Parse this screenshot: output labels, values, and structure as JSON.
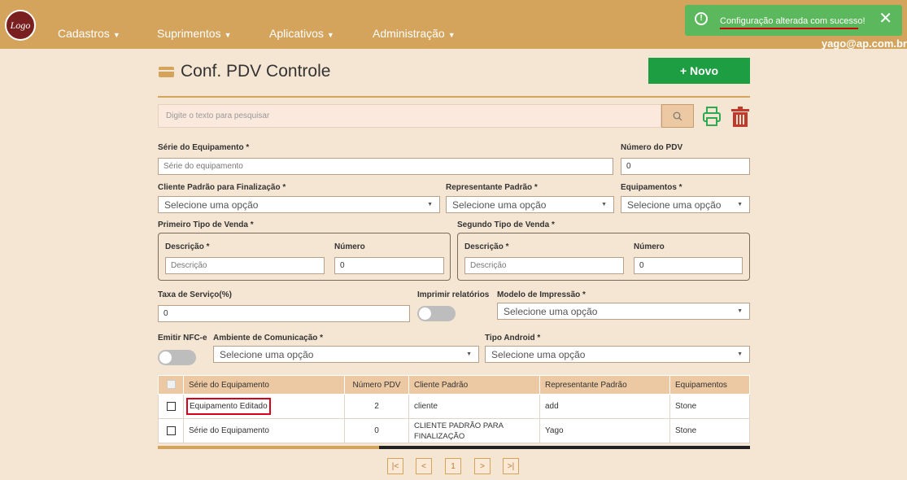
{
  "logo": {
    "text": "Logo"
  },
  "nav": {
    "items": [
      {
        "label": "Cadastros"
      },
      {
        "label": "Suprimentos"
      },
      {
        "label": "Aplicativos"
      },
      {
        "label": "Administração"
      }
    ],
    "user_email": "yago@ap.com.br"
  },
  "toast": {
    "message": "Configuração alterada com sucesso!",
    "icon": "info-circle-icon",
    "color": "#5cb85c"
  },
  "page": {
    "title": "Conf. PDV Controle",
    "new_button": "+ Novo"
  },
  "search": {
    "placeholder": "Digite o texto para pesquisar"
  },
  "form": {
    "serie_label": "Série do Equipamento *",
    "serie_placeholder": "Série do equipamento",
    "numero_pdv_label": "Número do PDV",
    "numero_pdv_value": "0",
    "cliente_label": "Cliente Padrão para Finalização *",
    "cliente_value": "Selecione uma opção",
    "representante_label": "Representante Padrão *",
    "representante_value": "Selecione uma opção",
    "equipamentos_label": "Equipamentos *",
    "equipamentos_value": "Selecione uma opção",
    "primeiro_tipo_label": "Primeiro Tipo de Venda *",
    "segundo_tipo_label": "Segundo Tipo de Venda *",
    "descricao_label": "Descrição *",
    "descricao_placeholder": "Descrição",
    "numero_label": "Número",
    "primeiro_numero_value": "0",
    "segundo_numero_value": "0",
    "taxa_label": "Taxa de Serviço(%)",
    "taxa_value": "0",
    "imprimir_label": "Imprimir relatórios",
    "modelo_label": "Modelo de Impressão *",
    "modelo_value": "Selecione uma opção",
    "nfce_label": "Emitir NFC-e",
    "ambiente_label": "Ambiente de Comunicação *",
    "ambiente_value": "Selecione uma opção",
    "tipo_android_label": "Tipo Android *",
    "tipo_android_value": "Selecione uma opção"
  },
  "table": {
    "columns": [
      "Série do Equipamento",
      "Número PDV",
      "Cliente Padrão",
      "Representante Padrão",
      "Equipamentos"
    ],
    "rows": [
      {
        "serie": "Equipamento Editado",
        "numero": "2",
        "cliente": "cliente",
        "representante": "add",
        "equipamentos": "Stone"
      },
      {
        "serie": "Série do Equipamento",
        "numero": "0",
        "cliente": "CLIENTE PADRÃO PARA FINALIZAÇÃO",
        "representante": "Yago",
        "equipamentos": "Stone"
      }
    ]
  },
  "pagination": {
    "first": "|<",
    "prev": "<",
    "current": "1",
    "next": ">",
    "last": ">|"
  },
  "colors": {
    "topbar": "#d4a35c",
    "background": "#f5e6d3",
    "primary_button": "#1e9e43",
    "print_icon": "#2eaa53",
    "trash_icon": "#c0392b"
  }
}
